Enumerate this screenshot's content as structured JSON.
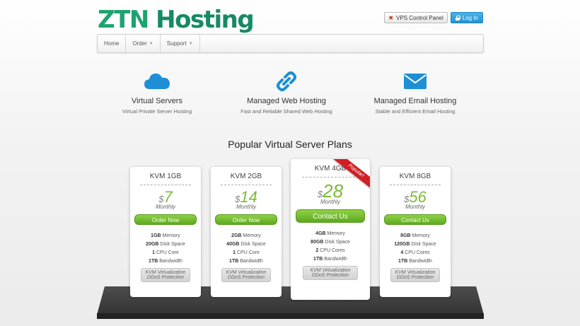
{
  "brand": {
    "name_part1": "ZTN",
    "name_part2": "Hosting"
  },
  "header": {
    "vps_panel_label": "VPS Control Panel",
    "login_label": "Log In"
  },
  "nav": {
    "items": [
      {
        "label": "Home"
      },
      {
        "label": "Order"
      },
      {
        "label": "Support"
      }
    ]
  },
  "features": [
    {
      "title": "Virtual Servers",
      "subtitle": "Virtual Private Server Hosting",
      "icon": "cloud-icon"
    },
    {
      "title": "Managed Web Hosting",
      "subtitle": "Fast and Reliable Shared Web Hosting",
      "icon": "link-icon"
    },
    {
      "title": "Managed Email Hosting",
      "subtitle": "Stable and Efficient Email Hosting",
      "icon": "envelope-icon"
    }
  ],
  "plans_title": "Popular Virtual Server Plans",
  "plans": [
    {
      "name": "KVM 1GB",
      "currency": "$",
      "price": "7",
      "period": "Monthly",
      "cta": "Order Now",
      "specs": [
        {
          "v": "1GB",
          "u": "Memory"
        },
        {
          "v": "20GB",
          "u": "Disk Space"
        },
        {
          "v": "1",
          "u": "CPU Core"
        },
        {
          "v": "1TB",
          "u": "Bandwidth"
        }
      ],
      "virt1": "KVM Virtualization",
      "virt2": "DDoS Protection"
    },
    {
      "name": "KVM 2GB",
      "currency": "$",
      "price": "14",
      "period": "Monthly",
      "cta": "Order Now",
      "specs": [
        {
          "v": "2GB",
          "u": "Memory"
        },
        {
          "v": "40GB",
          "u": "Disk Space"
        },
        {
          "v": "1",
          "u": "CPU Core"
        },
        {
          "v": "1TB",
          "u": "Bandwidth"
        }
      ],
      "virt1": "KVM Virtualization",
      "virt2": "DDoS Protection"
    },
    {
      "name": "KVM 4GB",
      "currency": "$",
      "price": "28",
      "period": "Monthly",
      "cta": "Contact Us",
      "ribbon": "Popular!",
      "specs": [
        {
          "v": "4GB",
          "u": "Memory"
        },
        {
          "v": "80GB",
          "u": "Disk Space"
        },
        {
          "v": "2",
          "u": "CPU Cores"
        },
        {
          "v": "1TB",
          "u": "Bandwidth"
        }
      ],
      "virt1": "KVM Virtualization",
      "virt2": "DDoS Protection"
    },
    {
      "name": "KVM 8GB",
      "currency": "$",
      "price": "56",
      "period": "Monthly",
      "cta": "Contact Us",
      "specs": [
        {
          "v": "8GB",
          "u": "Memory"
        },
        {
          "v": "120GB",
          "u": "Disk Space"
        },
        {
          "v": "4",
          "u": "CPU Cores"
        },
        {
          "v": "1TB",
          "u": "Bandwidth"
        }
      ],
      "virt1": "KVM Virtualization",
      "virt2": "DDoS Protection"
    }
  ],
  "colors": {
    "brand_green": "#1ea36f",
    "price_green": "#7bb936",
    "cta_green": "#5da91e",
    "login_blue": "#2493cf",
    "ribbon_red": "#d11e25"
  }
}
